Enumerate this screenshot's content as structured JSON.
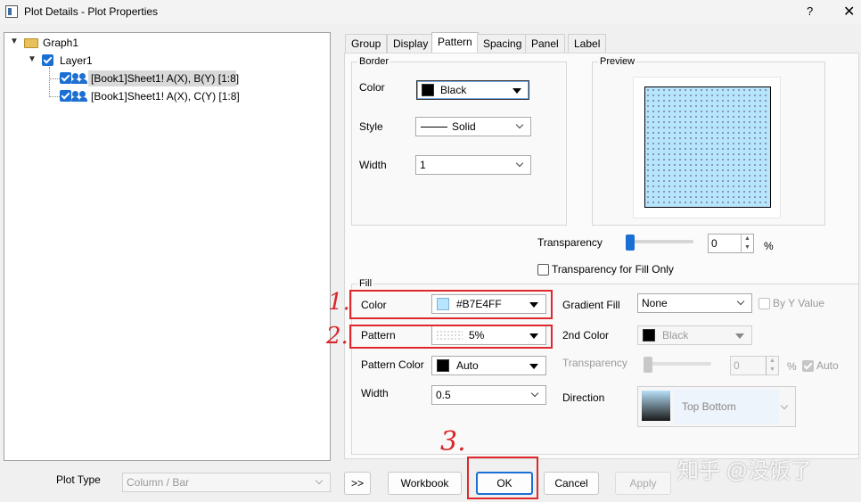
{
  "window": {
    "title": "Plot Details - Plot Properties",
    "help_glyph": "?",
    "close_glyph": "✕"
  },
  "tree": {
    "root": "Graph1",
    "layer": "Layer1",
    "items": [
      "[Book1]Sheet1! A(X), B(Y) [1:8]",
      "[Book1]Sheet1! A(X), C(Y) [1:8]"
    ]
  },
  "tabs": [
    "Group",
    "Display",
    "Pattern",
    "Spacing",
    "Panel",
    "Label"
  ],
  "active_tab": "Pattern",
  "border": {
    "group_label": "Border",
    "color_label": "Color",
    "color_value": "Black",
    "color_swatch": "#000000",
    "style_label": "Style",
    "style_value": "Solid",
    "width_label": "Width",
    "width_value": "1"
  },
  "preview": {
    "group_label": "Preview",
    "fill_color": "#B7E4FF"
  },
  "transparency": {
    "label": "Transparency",
    "value": "0",
    "unit": "%",
    "level": 0
  },
  "fill_only_checkbox": "Transparency for Fill Only",
  "fill": {
    "group_label": "Fill",
    "color_label": "Color",
    "color_value": "#B7E4FF",
    "color_swatch": "#B7E4FF",
    "pattern_label": "Pattern",
    "pattern_value": "5%",
    "pattern_color_label": "Pattern Color",
    "pattern_color_value": "Auto",
    "pattern_color_swatch": "#000000",
    "width_label": "Width",
    "width_value": "0.5",
    "gradient_label": "Gradient Fill",
    "gradient_value": "None",
    "by_y_value": "By Y Value",
    "second_color_label": "2nd Color",
    "second_color_value": "Black",
    "transparency_label": "Transparency",
    "transparency_value": "0",
    "transparency_unit": "%",
    "auto_label": "Auto",
    "direction_label": "Direction",
    "direction_value": "Top Bottom"
  },
  "annotations": [
    "1.",
    "2.",
    "3."
  ],
  "bottom": {
    "plot_type_label": "Plot Type",
    "plot_type_value": "Column / Bar",
    "expand_button": ">>",
    "workbook_button": "Workbook",
    "ok_button": "OK",
    "cancel_button": "Cancel",
    "apply_button": "Apply"
  },
  "watermark": "知乎 @没饭了",
  "colors": {
    "highlight_red": "#e0282c",
    "accent_blue": "#1a6fd4"
  }
}
